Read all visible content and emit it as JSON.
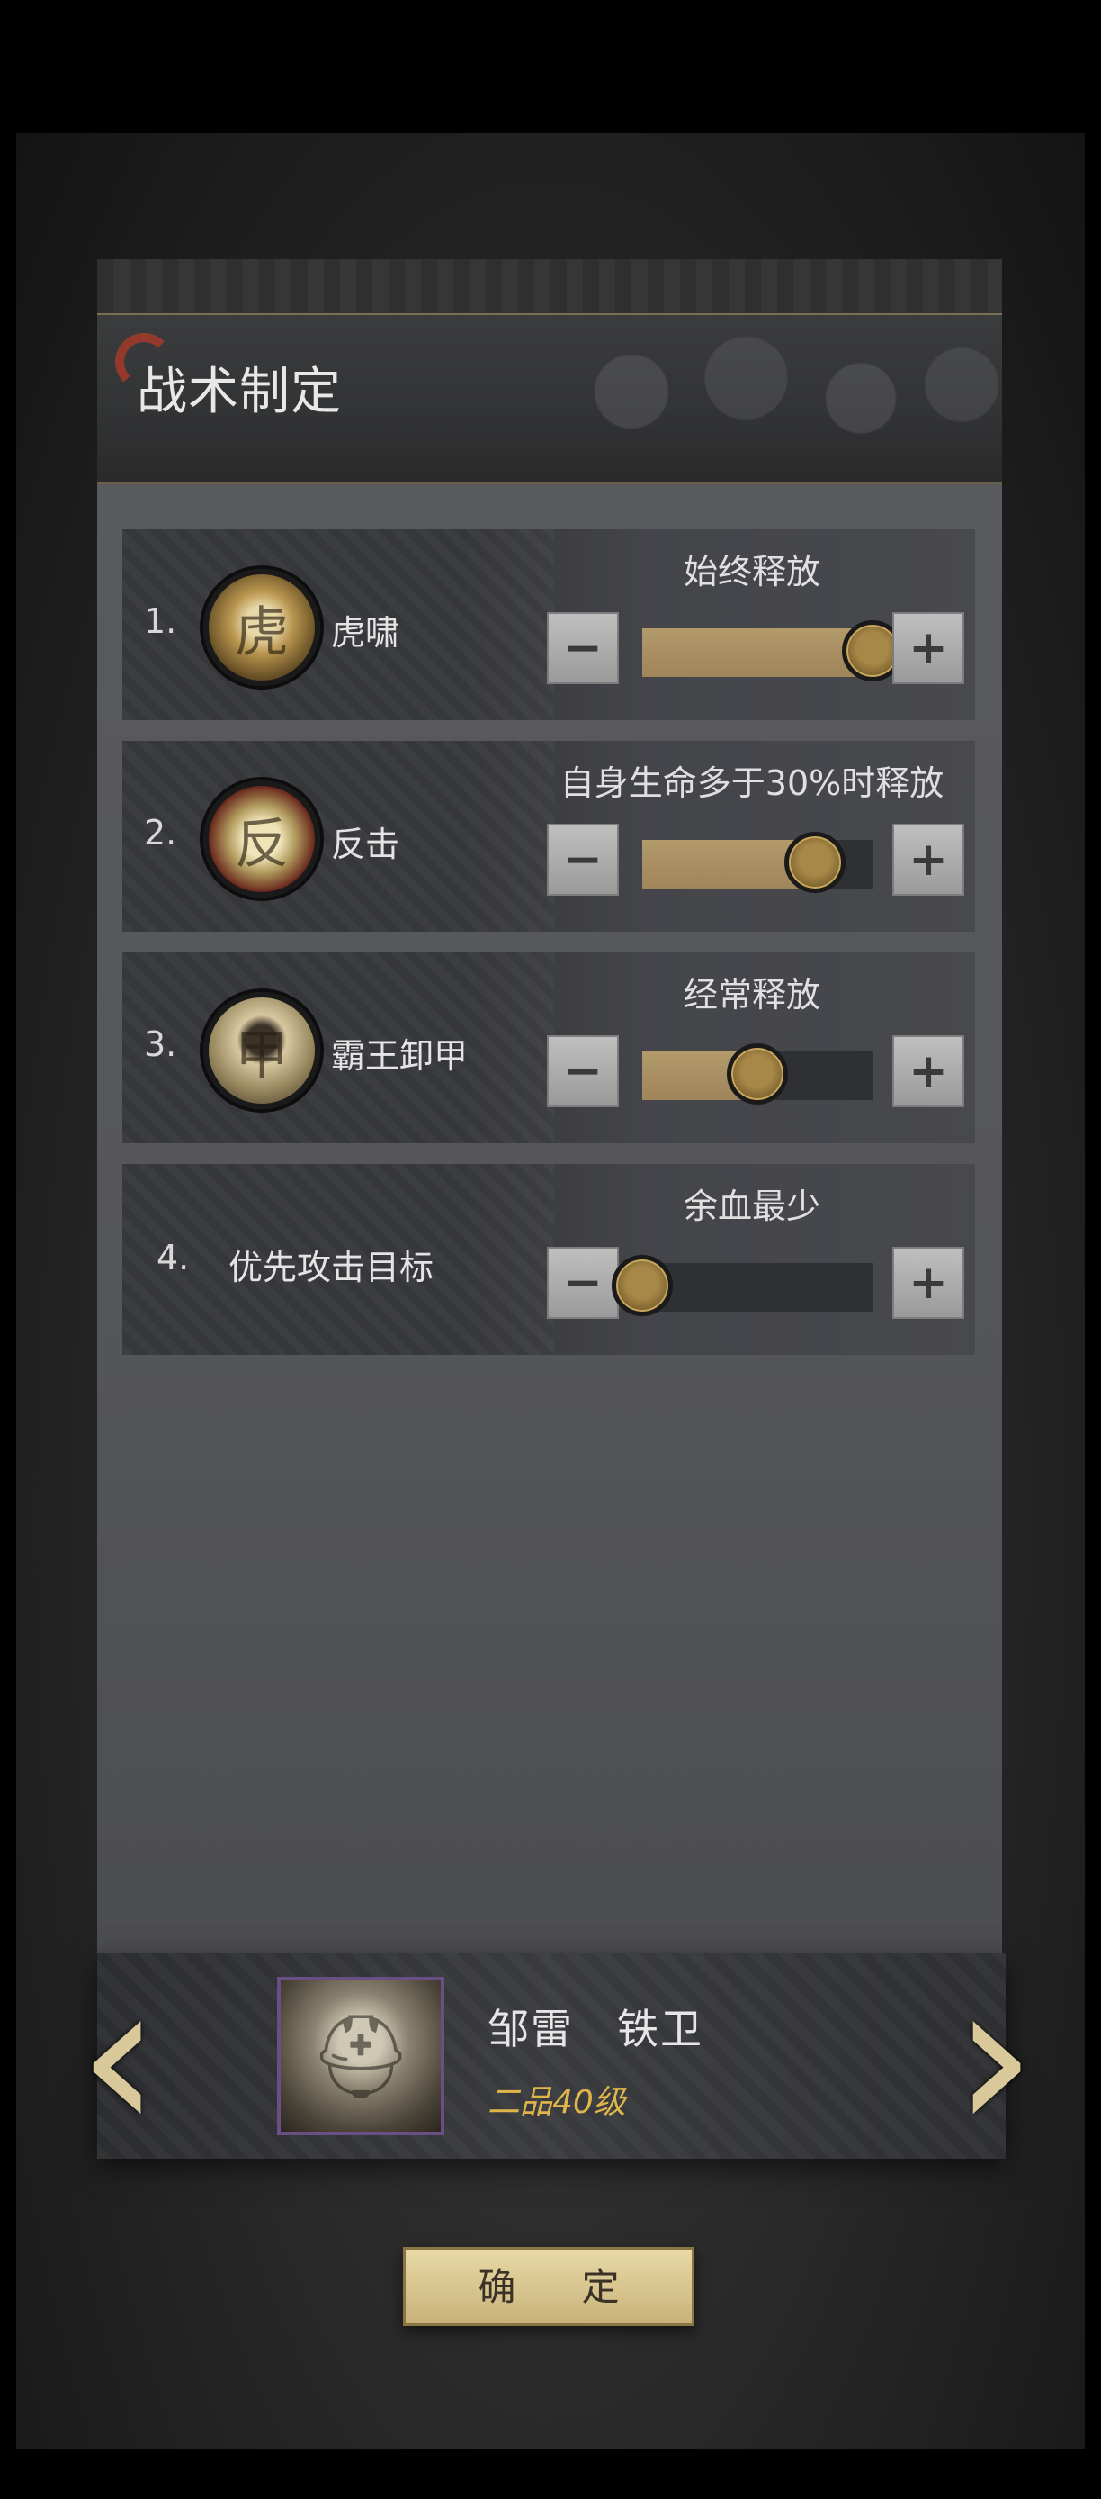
{
  "panel": {
    "title": "战术制定"
  },
  "tactics": [
    {
      "num": "1.",
      "name": "虎啸",
      "status": "始终释放",
      "level": 1.0,
      "icon": "tiger-roar-icon"
    },
    {
      "num": "2.",
      "name": "反击",
      "status": "自身生命多于30%时释放",
      "level": 0.75,
      "icon": "counter-attack-icon"
    },
    {
      "num": "3.",
      "name": "霸王卸甲",
      "status": "经常释放",
      "level": 0.5,
      "icon": "overlord-armor-icon"
    },
    {
      "num": "4.",
      "name": "优先攻击目标",
      "status": "余血最少",
      "level": 0.0
    }
  ],
  "buttons": {
    "minus": "−",
    "plus": "+"
  },
  "character": {
    "name": "邹雷　铁卫",
    "rank": "二品40级"
  },
  "nav": {
    "prev": "‹",
    "next": "›"
  },
  "confirm_label": "确  定",
  "colors": {
    "accent_gold": "#e0b64a",
    "slider_fill": "#a88e60",
    "portrait_border": "#6a4f86"
  }
}
